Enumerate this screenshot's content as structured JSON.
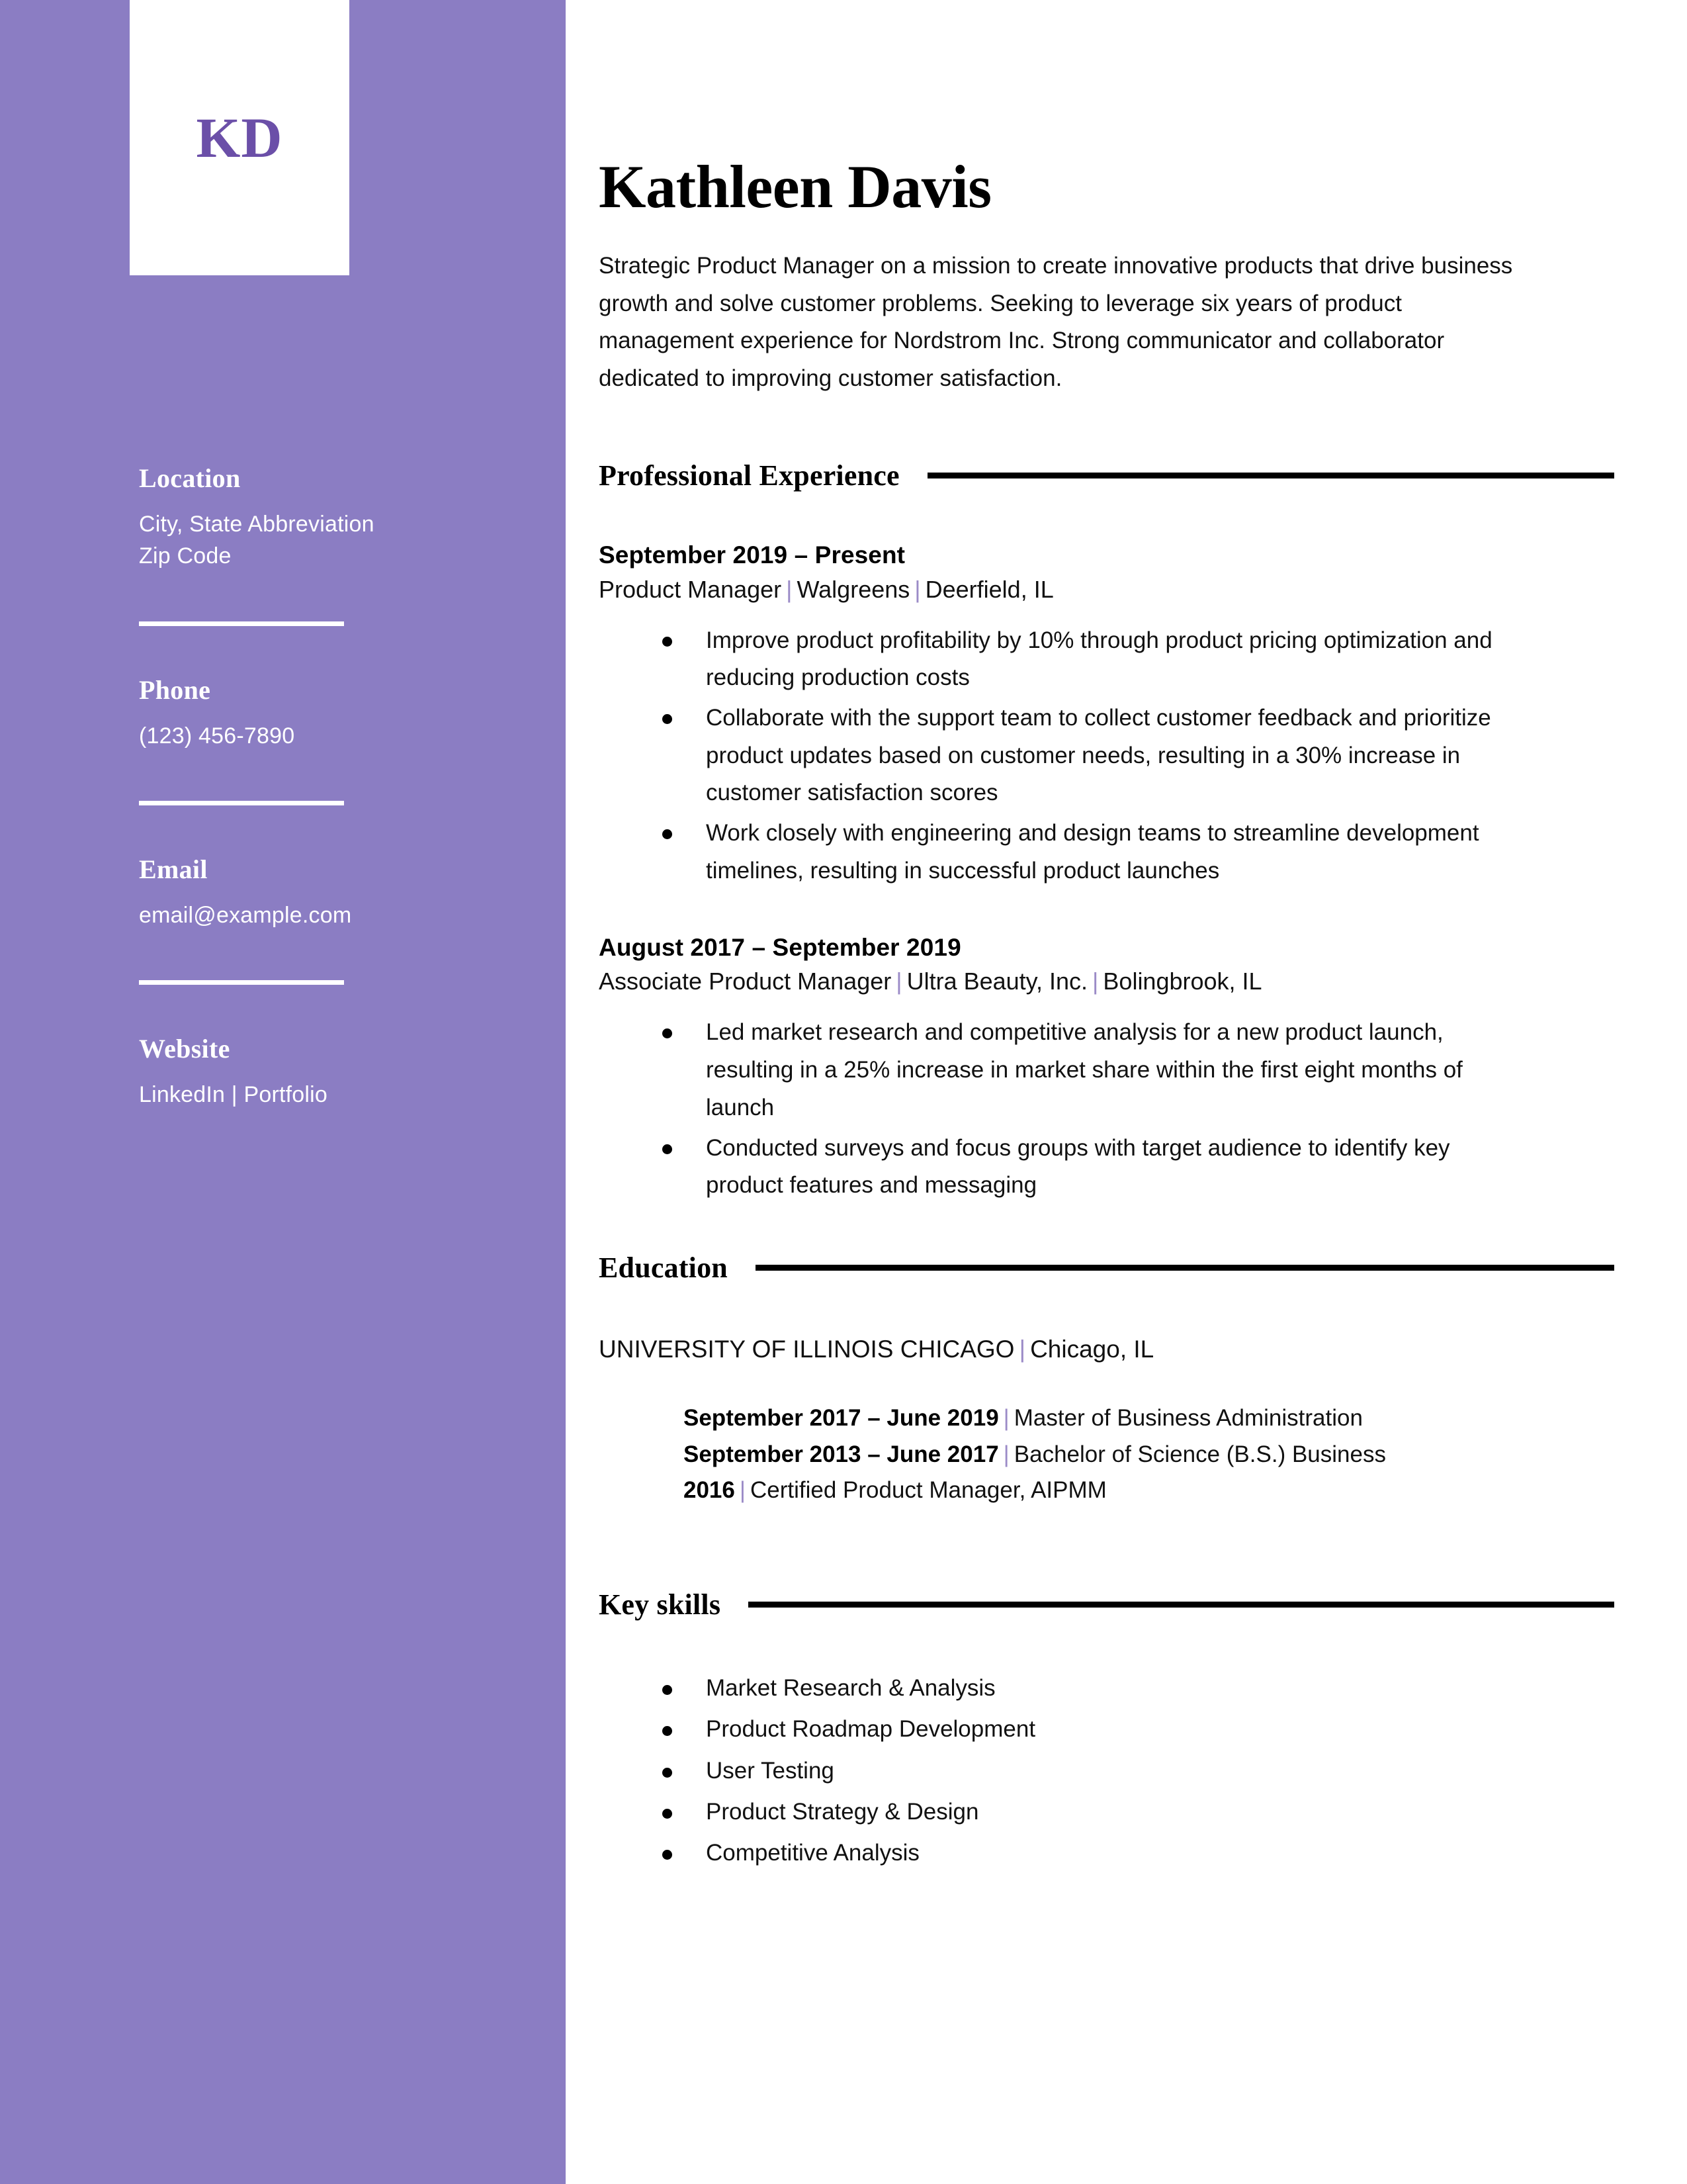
{
  "colors": {
    "sidebar_bg": "#8B7DC3",
    "monogram_text": "#6B4FA8",
    "separator_pipe": "#9B8BC7",
    "rule": "#000000",
    "body_text": "#111111",
    "sidebar_text": "#FFFFFF"
  },
  "sidebar": {
    "monogram": "KD",
    "contact_sections": [
      {
        "heading": "Location",
        "lines": [
          "City, State Abbreviation",
          "Zip Code"
        ]
      },
      {
        "heading": "Phone",
        "lines": [
          "(123) 456-7890"
        ]
      },
      {
        "heading": "Email",
        "lines": [
          "email@example.com"
        ]
      },
      {
        "heading": "Website",
        "lines": [
          "LinkedIn | Portfolio"
        ]
      }
    ]
  },
  "header": {
    "name": "Kathleen Davis",
    "summary": "Strategic Product Manager on a mission to create innovative products that drive business growth and solve customer problems. Seeking to leverage six years of product management experience for Nordstrom Inc. Strong communicator and collaborator dedicated to improving customer satisfaction."
  },
  "sections": {
    "experience": {
      "title": "Professional Experience",
      "jobs": [
        {
          "dates": "September 2019 – Present",
          "role": "Product Manager",
          "company": "Walgreens",
          "location": "Deerfield, IL",
          "bullets": [
            "Improve product profitability by 10% through product pricing optimization and reducing production costs",
            "Collaborate with the support team to collect customer feedback and prioritize product updates based on customer needs, resulting in a 30% increase in customer satisfaction scores",
            "Work closely with engineering and design teams to streamline development timelines, resulting in successful product launches"
          ]
        },
        {
          "dates": "August 2017 – September 2019",
          "role": "Associate Product Manager",
          "company": "Ultra Beauty, Inc.",
          "location": "Bolingbrook, IL",
          "bullets": [
            "Led market research and competitive analysis for a new product launch, resulting in a 25% increase in market share within the first eight months of launch",
            "Conducted surveys and focus groups with target audience to identify key product features and messaging"
          ]
        }
      ]
    },
    "education": {
      "title": "Education",
      "school": "UNIVERSITY OF ILLINOIS CHICAGO",
      "school_location": "Chicago, IL",
      "entries": [
        {
          "dates": "September 2017 – June 2019",
          "detail": "Master of Business Administration"
        },
        {
          "dates": "September 2013 – June 2017",
          "detail": "Bachelor of Science (B.S.) Business"
        },
        {
          "dates": "2016",
          "detail": "Certified Product Manager, AIPMM"
        }
      ]
    },
    "skills": {
      "title": "Key skills",
      "items": [
        "Market Research & Analysis",
        "Product Roadmap Development",
        "User Testing",
        "Product Strategy & Design",
        "Competitive Analysis"
      ]
    }
  }
}
